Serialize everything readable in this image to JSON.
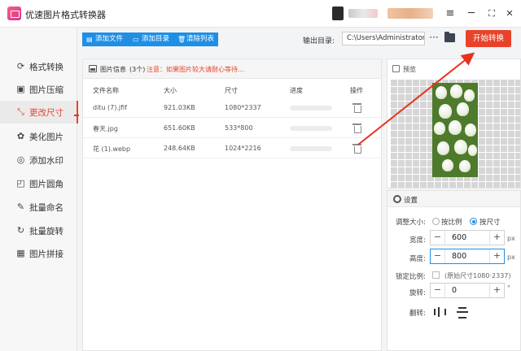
{
  "app": {
    "title": "优速图片格式转换器"
  },
  "window_controls": {
    "menu": "≡",
    "minimize": "─",
    "maximize": "⛶",
    "close": "✕"
  },
  "sidebar": {
    "items": [
      {
        "label": "格式转换",
        "icon": "refresh-icon",
        "glyph": "⟳"
      },
      {
        "label": "图片压缩",
        "icon": "compress-icon",
        "glyph": "▣"
      },
      {
        "label": "更改尺寸",
        "icon": "resize-icon",
        "glyph": "⤡",
        "active": true
      },
      {
        "label": "美化图片",
        "icon": "palette-icon",
        "glyph": "✿"
      },
      {
        "label": "添加水印",
        "icon": "watermark-icon",
        "glyph": "◎"
      },
      {
        "label": "图片圆角",
        "icon": "round-corner-icon",
        "glyph": "◰"
      },
      {
        "label": "批量命名",
        "icon": "rename-icon",
        "glyph": "✎"
      },
      {
        "label": "批量旋转",
        "icon": "rotate-icon",
        "glyph": "↻"
      },
      {
        "label": "图片拼接",
        "icon": "collage-icon",
        "glyph": "▦"
      }
    ]
  },
  "toolbar": {
    "add_file": "添加文件",
    "add_folder": "添加目录",
    "clear_list": "清除列表",
    "output_label": "输出目录:",
    "output_path": "C:\\Users\\Administrator\\",
    "browse": "···",
    "start": "开始转换"
  },
  "file_panel": {
    "title": "图片信息",
    "count": "(3个)",
    "note": "注意：如果图片较大请耐心等待...",
    "columns": [
      "文件名称",
      "大小",
      "尺寸",
      "进度",
      "操作"
    ],
    "rows": [
      {
        "name": "ditu (7).jfif",
        "size": "921.03KB",
        "dims": "1080*2337",
        "progress": 0
      },
      {
        "name": "春天.jpg",
        "size": "651.60KB",
        "dims": "533*800",
        "progress": 0
      },
      {
        "name": "花 (1).webp",
        "size": "248.64KB",
        "dims": "1024*2216",
        "progress": 0
      }
    ]
  },
  "preview": {
    "title": "预览"
  },
  "settings": {
    "title": "设置",
    "resize_label": "调整大小:",
    "by_ratio": "按比例",
    "by_size": "按尺寸",
    "selected_mode": "按尺寸",
    "width_label": "宽度:",
    "width_value": "600",
    "height_label": "高度:",
    "height_value": "800",
    "unit": "px",
    "lock_label": "锁定比例:",
    "original_size": "(原始尺寸1080·2337)",
    "rotate_label": "旋转:",
    "rotate_value": "0",
    "rotate_unit": "°",
    "flip_label": "翻转:"
  },
  "colors": {
    "accent": "#e8432a",
    "primary": "#1f8fe5"
  }
}
